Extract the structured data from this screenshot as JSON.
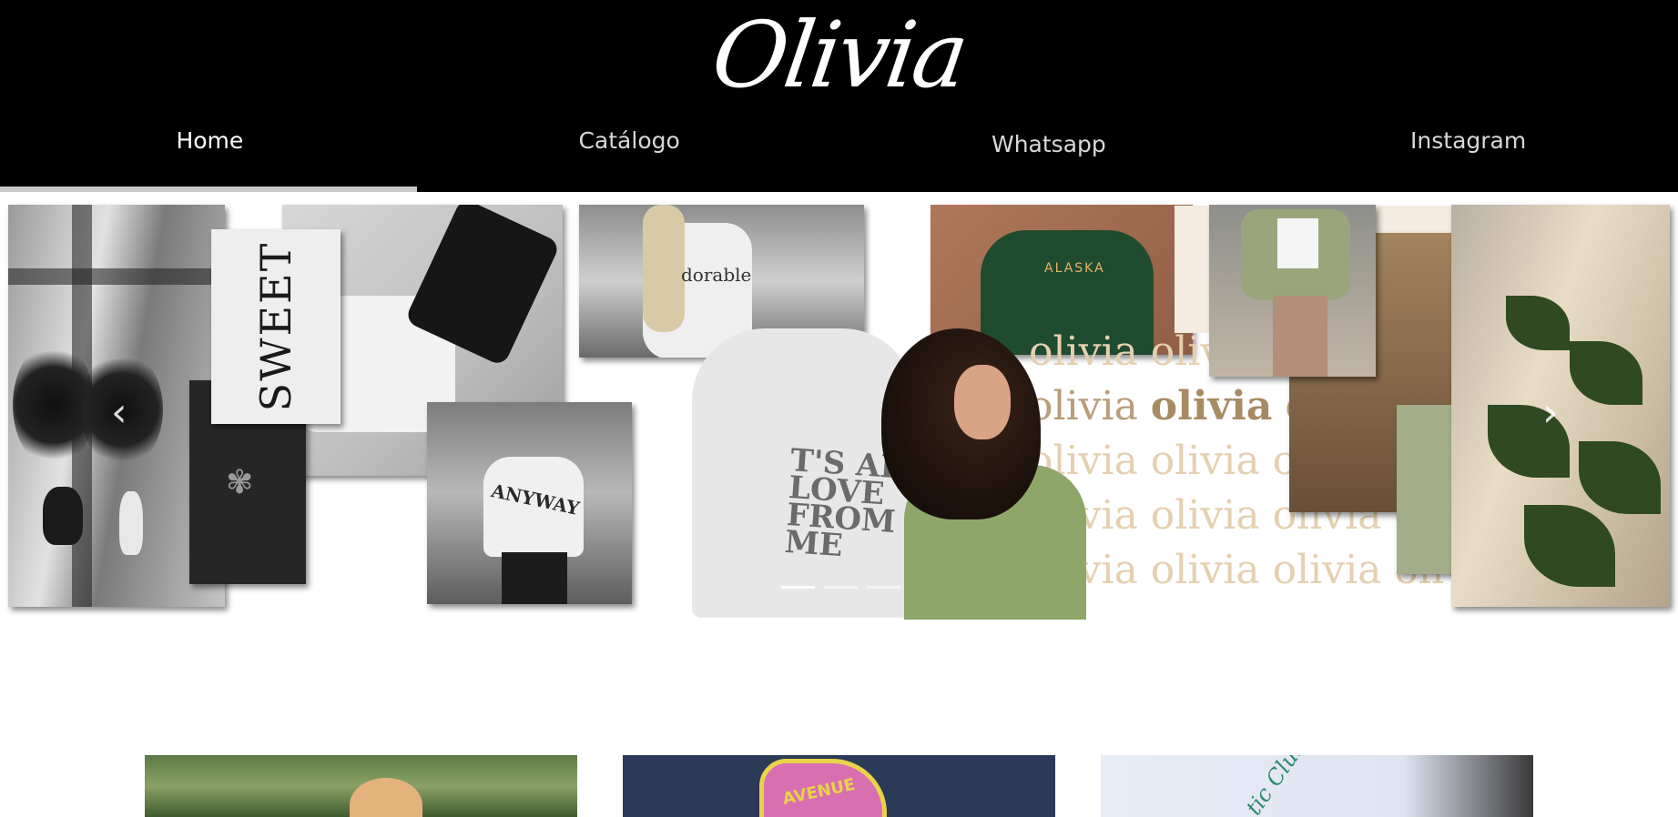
{
  "brand": {
    "logo_text": "Olivia"
  },
  "nav": {
    "items": [
      {
        "label": "Home",
        "active": true
      },
      {
        "label": "Catálogo",
        "active": false
      },
      {
        "label": "Whatsapp",
        "active": false
      },
      {
        "label": "Instagram",
        "active": false
      }
    ]
  },
  "carousel": {
    "slide_count": 3,
    "active_slide": 1,
    "collage": {
      "sweet_card_text": "SWEET",
      "sweater_text": "ANYWAY",
      "sweater2_text": "dorable",
      "hoodie_text": "T'S ALL\nLOVE\nFROM\nME",
      "alaska_text": "ALASKA",
      "pattern_word": "olivia"
    },
    "prev_icon": "chevron-left-icon",
    "next_icon": "chevron-right-icon"
  },
  "products": {
    "items": [
      {
        "print_text": ""
      },
      {
        "print_text": "AVENUE"
      },
      {
        "print_text": "tic Club"
      }
    ]
  },
  "colors": {
    "header_bg": "#000000",
    "nav_text": "#d8d8d8",
    "nav_active_text": "#ffffff",
    "active_underline": "#c8c8c8"
  }
}
